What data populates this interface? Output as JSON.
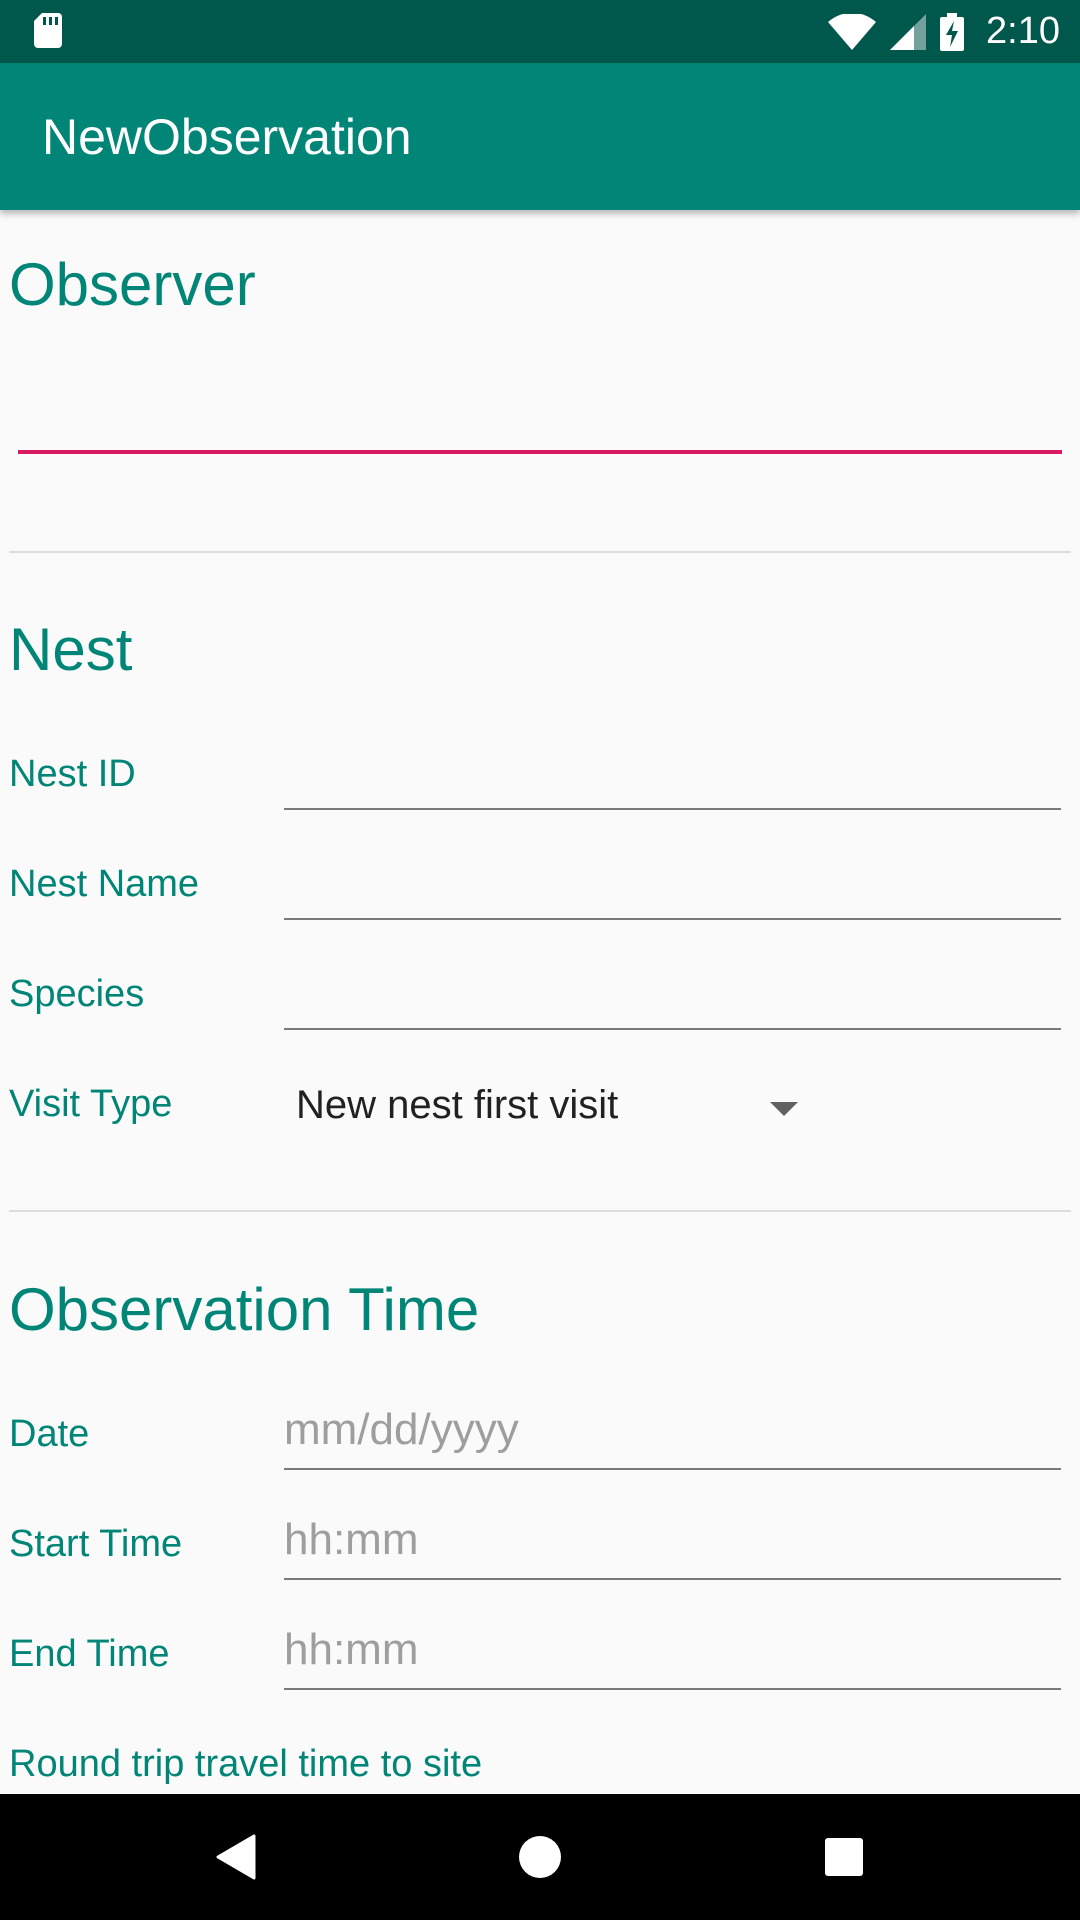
{
  "status_bar": {
    "time": "2:10",
    "icons": [
      "sd-card-icon",
      "wifi-icon",
      "signal-icon",
      "battery-charging-icon"
    ]
  },
  "app_bar": {
    "title": "NewObservation"
  },
  "observer": {
    "title": "Observer",
    "value": ""
  },
  "nest": {
    "title": "Nest",
    "fields": [
      {
        "label": "Nest ID",
        "value": ""
      },
      {
        "label": "Nest Name",
        "value": ""
      },
      {
        "label": "Species",
        "value": ""
      }
    ],
    "visit_type": {
      "label": "Visit Type",
      "selected": "New nest first visit"
    }
  },
  "observation_time": {
    "title": "Observation Time",
    "fields": [
      {
        "label": "Date",
        "placeholder": "mm/dd/yyyy"
      },
      {
        "label": "Start Time",
        "placeholder": "hh:mm"
      },
      {
        "label": "End Time",
        "placeholder": "hh:mm"
      }
    ],
    "travel_label": "Round trip travel time to site"
  },
  "nav_bar": {
    "icons": [
      "back-icon",
      "home-icon",
      "recents-icon"
    ]
  },
  "colors": {
    "primary": "#008577",
    "primary_dark": "#00574b",
    "accent": "#d81b60"
  }
}
